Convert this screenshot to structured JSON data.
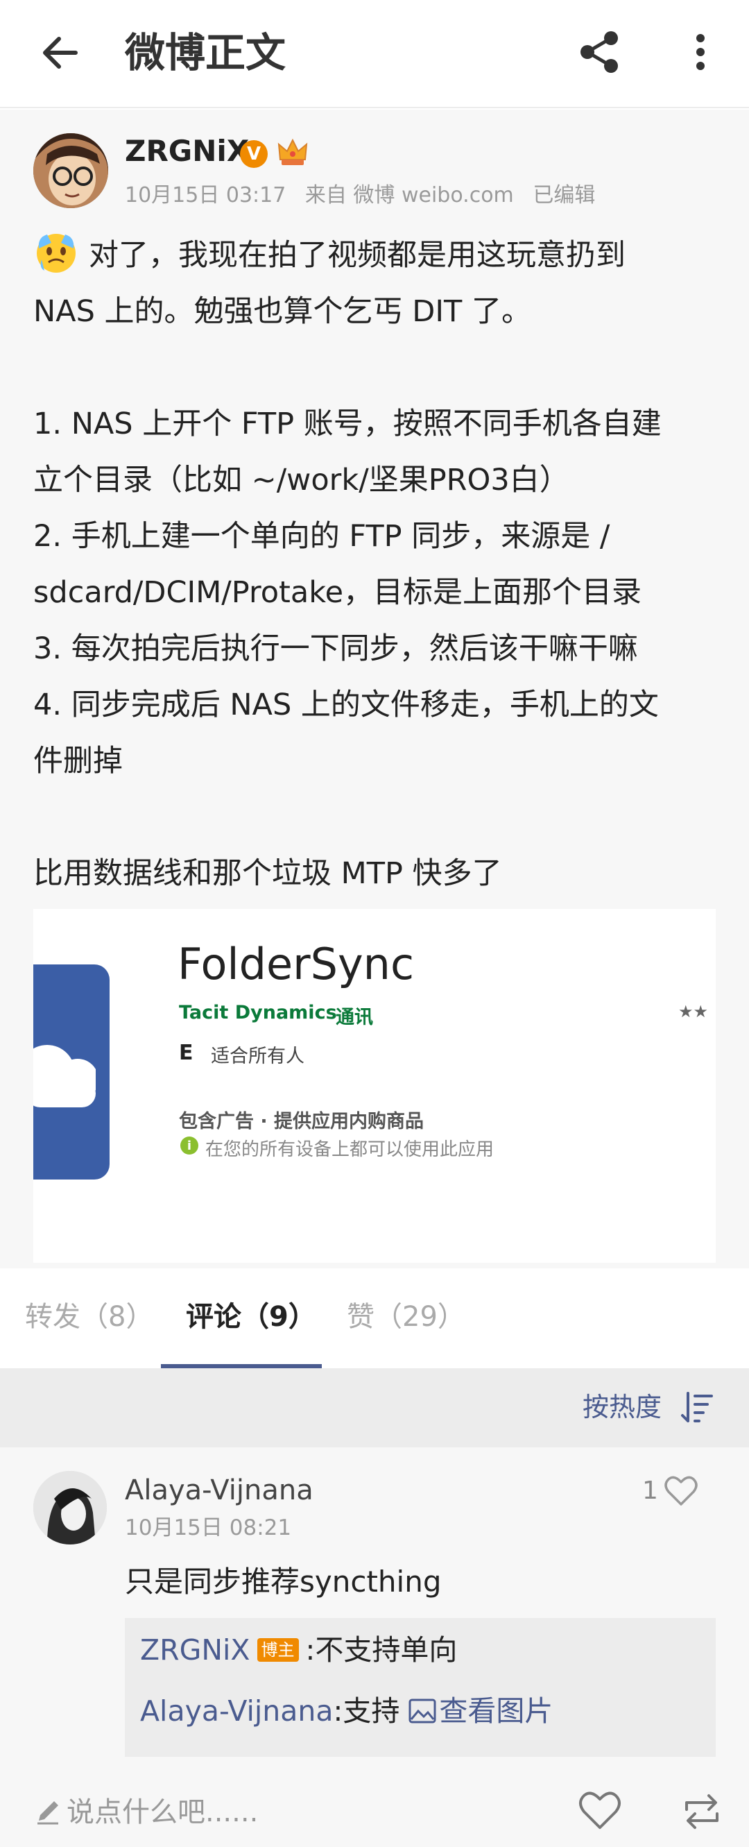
{
  "appbar": {
    "title": "微博正文",
    "back_icon": "arrow-left-icon",
    "share_icon": "share-icon",
    "more_icon": "more-vertical-icon"
  },
  "post": {
    "author": "ZRGNiX",
    "verified_badge": "V",
    "meta": {
      "date": "10月15日 03:17",
      "source": "来自 微博 weibo.com",
      "edited": "已编辑"
    },
    "lines": [
      "对了，我现在拍了视频都是用这玩意扔到",
      "NAS 上的。勉强也算个乞丐 DIT 了。",
      "",
      "1. NAS 上开个 FTP 账号，按照不同手机各自建",
      "立个目录（比如 ~/work/坚果PRO3白）",
      "2. 手机上建一个单向的 FTP 同步，来源是 /",
      "sdcard/DCIM/Protake，目标是上面那个目录",
      "3. 每次拍完后执行一下同步，然后该干嘛干嘛",
      "4. 同步完成后 NAS 上的文件移走，手机上的文",
      "件删掉",
      "",
      "比用数据线和那个垃圾 MTP 快多了"
    ],
    "embed": {
      "app_name": "FolderSync",
      "developer": "Tacit Dynamics",
      "category": "通讯",
      "stars": "★★",
      "rating_letter": "E",
      "rating_label": "适合所有人",
      "ads": "包含广告 · 提供应用内购商品",
      "info_mark": "i",
      "devices": "在您的所有设备上都可以使用此应用"
    }
  },
  "tabs": [
    {
      "label": "转发（8）",
      "active": false
    },
    {
      "label": "评论（9）",
      "active": true
    },
    {
      "label": "赞（29）",
      "active": false
    }
  ],
  "sort": {
    "label": "按热度"
  },
  "comment": {
    "name": "Alaya-Vijnana",
    "time": "10月15日 08:21",
    "likes": "1",
    "text": "只是同步推荐syncthing",
    "replies": [
      {
        "who": "ZRGNiX",
        "badge": "博主",
        "text": ":不支持单向"
      },
      {
        "who": "Alaya-Vijnana",
        "text": ":支持 ",
        "link": "查看图片"
      }
    ]
  },
  "bottom": {
    "compose_placeholder": "说点什么吧......"
  }
}
